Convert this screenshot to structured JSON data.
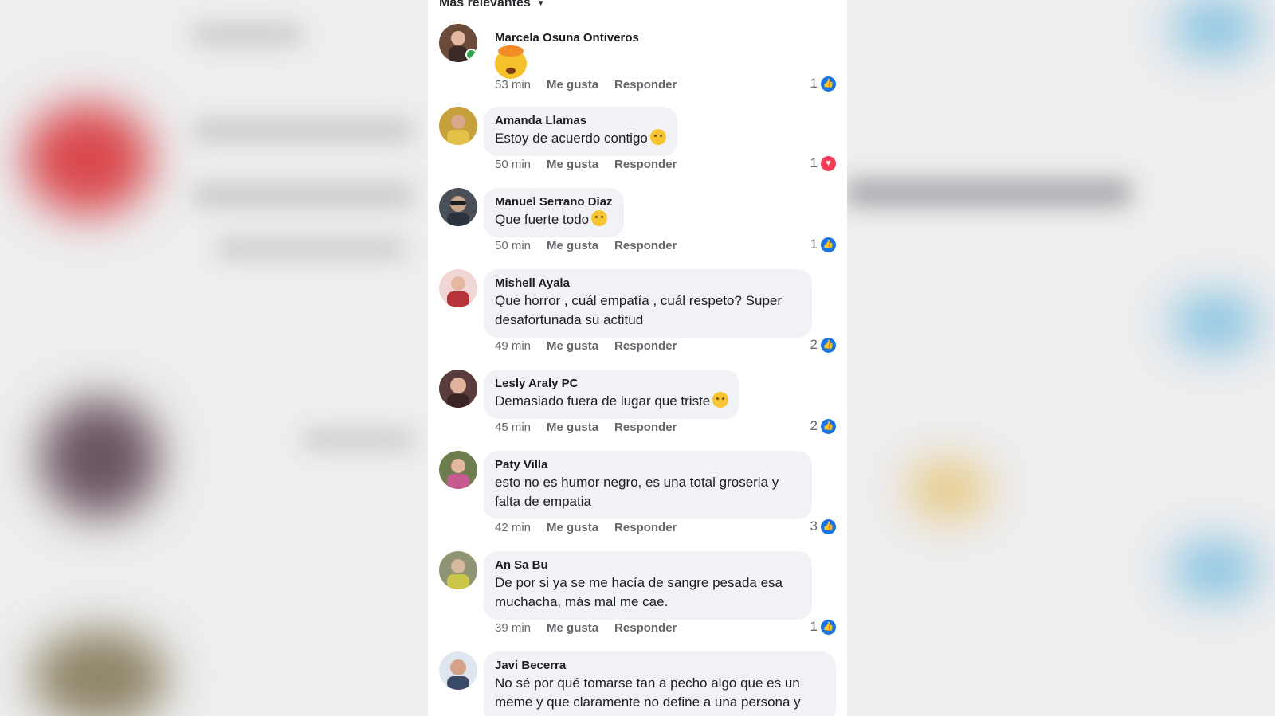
{
  "sort_label": "Más relevantes",
  "actions": {
    "like": "Me gusta",
    "reply": "Responder"
  },
  "colors": {
    "like": "#1b74e4",
    "love": "#f33e58",
    "online": "#31a24c",
    "bubble": "#f0f2f5"
  },
  "comments": [
    {
      "author": "Marcela Osuna Ontiveros",
      "text": "",
      "emoji": "exploding-head-emoji",
      "time": "53 min",
      "reactions": "1",
      "reaction_type": "like-icon",
      "online": true,
      "avatar_color": "#6b4b3a"
    },
    {
      "author": "Amanda Llamas",
      "text": "Estoy de acuerdo contigo",
      "emoji": "downcast-sweat-emoji",
      "time": "50 min",
      "reactions": "1",
      "reaction_type": "love-icon",
      "avatar_color": "#c6a03a"
    },
    {
      "author": "Manuel Serrano Diaz",
      "text": "Que fuerte todo",
      "emoji": "astonished-emoji",
      "time": "50 min",
      "reactions": "1",
      "reaction_type": "like-icon",
      "avatar_color": "#4b5058"
    },
    {
      "author": "Mishell Ayala",
      "text": "Que horror , cuál empatía , cuál respeto? Super desafortunada su actitud",
      "time": "49 min",
      "reactions": "2",
      "reaction_type": "like-icon",
      "avatar_color": "#b7333a"
    },
    {
      "author": "Lesly Araly PC",
      "text": "Demasiado fuera de lugar que triste",
      "emoji": "disappointed-emoji",
      "time": "45 min",
      "reactions": "2",
      "reaction_type": "like-icon",
      "avatar_color": "#5a3c3c"
    },
    {
      "author": "Paty Villa",
      "text": "esto no es humor negro, es una total groseria y falta de empatia",
      "time": "42 min",
      "reactions": "3",
      "reaction_type": "like-icon",
      "avatar_color": "#6e7d4e"
    },
    {
      "author": "An Sa Bu",
      "text": "De por si ya se me hacía de sangre pesada esa muchacha, más mal me cae.",
      "time": "39 min",
      "reactions": "1",
      "reaction_type": "like-icon",
      "avatar_color": "#8e9474"
    },
    {
      "author": "Javi Becerra",
      "text": "No sé por qué tomarse tan a pecho algo que es un meme y que claramente no define a una persona y",
      "time": "",
      "reactions": "",
      "avatar_color": "#3b4a66"
    }
  ]
}
